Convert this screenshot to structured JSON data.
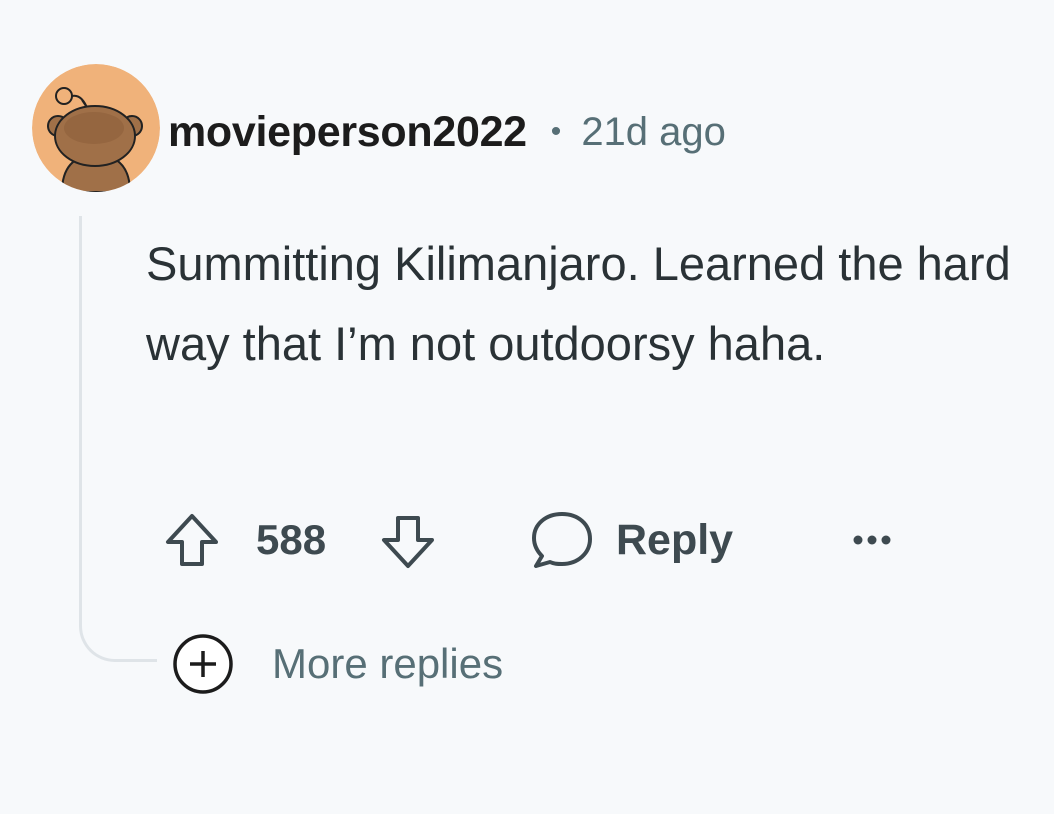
{
  "comment": {
    "username": "movieperson2022",
    "separator": "•",
    "timestamp": "21d ago",
    "body": "Summitting Kilimanjaro. Learned the hard way that I’m not outdoorsy haha.",
    "avatar_color": "#f0b27a",
    "accent_text_color": "#576f76"
  },
  "actions": {
    "upvote_icon": "arrow-up-outline-icon",
    "vote_count": "588",
    "downvote_icon": "arrow-down-outline-icon",
    "reply_icon": "speech-bubble-icon",
    "reply_label": "Reply",
    "overflow_icon": "ellipsis-icon"
  },
  "thread": {
    "expand_icon": "plus-circle-icon",
    "more_replies_label": "More replies"
  }
}
